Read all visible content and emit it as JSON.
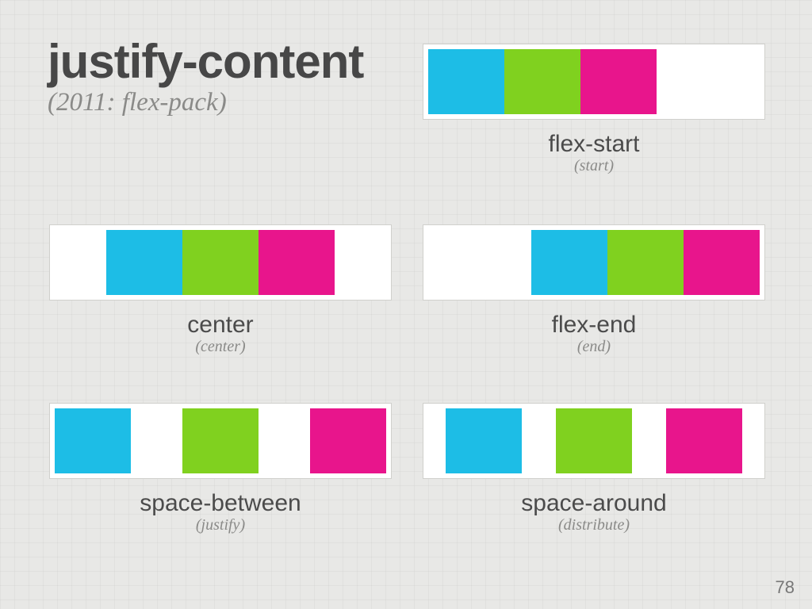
{
  "title": "justify-content",
  "subtitle": "(2011: flex-pack)",
  "page": "78",
  "examples": {
    "flex_start": {
      "label": "flex-start",
      "note": "(start)",
      "css": "flex-start"
    },
    "center": {
      "label": "center",
      "note": "(center)",
      "css": "center"
    },
    "flex_end": {
      "label": "flex-end",
      "note": "(end)",
      "css": "flex-end"
    },
    "space_between": {
      "label": "space-between",
      "note": "(justify)",
      "css": "space-between"
    },
    "space_around": {
      "label": "space-around",
      "note": "(distribute)",
      "css": "space-around"
    }
  }
}
